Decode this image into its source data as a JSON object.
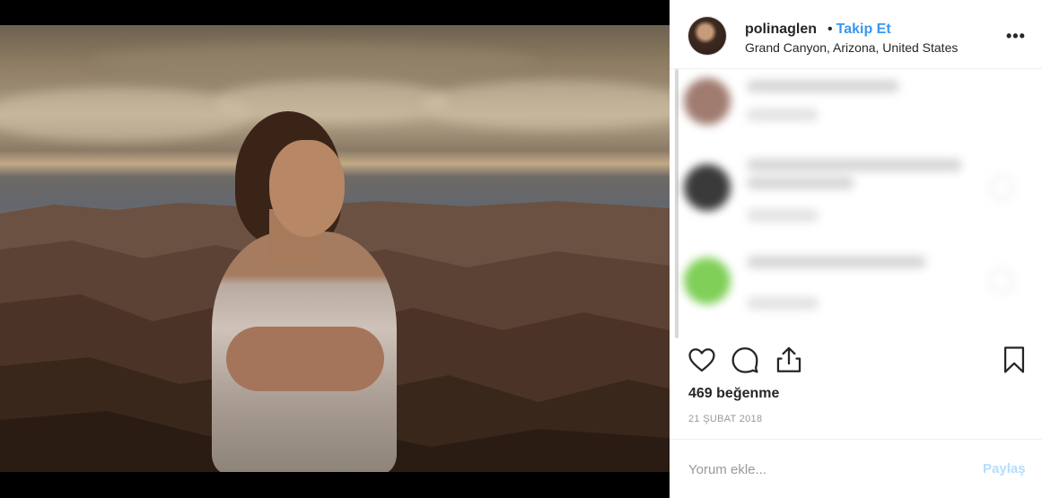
{
  "post": {
    "image_alt": "Woman in a satin off-shoulder dress standing at the Grand Canyon rim at sunset",
    "header": {
      "username": "polinaglen",
      "separator": "•",
      "follow_label": "Takip Et",
      "location": "Grand Canyon, Arizona, United States",
      "more_icon": "more-horizontal-icon",
      "more_label": "•••"
    },
    "actions": {
      "like_icon": "heart-icon",
      "comment_icon": "comment-icon",
      "share_icon": "share-icon",
      "save_icon": "bookmark-icon"
    },
    "likes_text": "469 beğenme",
    "date_text": "21 ŞUBAT 2018",
    "add_comment": {
      "placeholder": "Yorum ekle...",
      "post_label": "Paylaş"
    },
    "colors": {
      "link_blue": "#3897f0",
      "disabled_post": "#b2dffc",
      "text": "#262626",
      "muted": "#999999"
    }
  }
}
